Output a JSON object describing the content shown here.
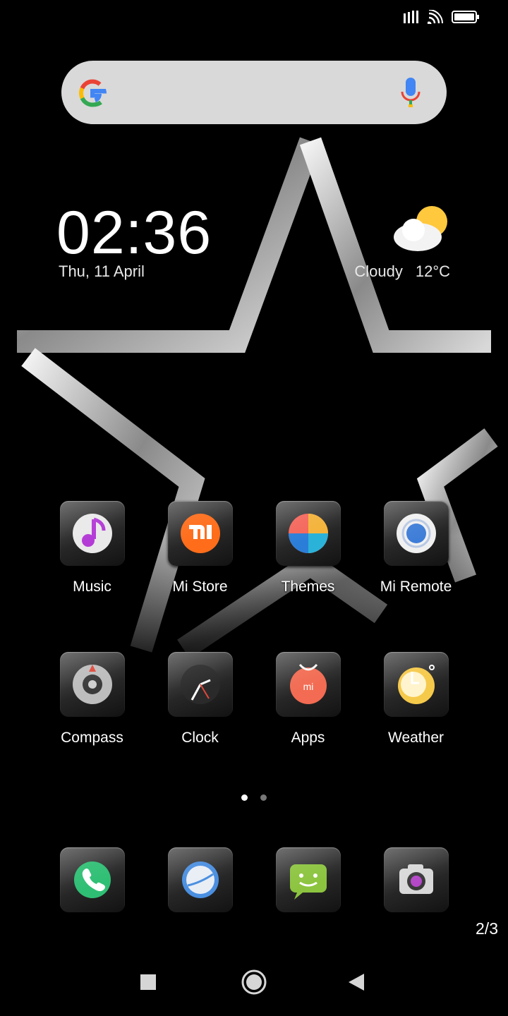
{
  "status_bar": {
    "signal_icon": "signal-bars-icon",
    "wifi_icon": "wifi-icon",
    "battery_icon": "battery-icon"
  },
  "search": {
    "value": "",
    "logo_icon": "google-g-icon",
    "mic_icon": "microphone-icon"
  },
  "clock_widget": {
    "time": "02:36",
    "date": "Thu, 11 April"
  },
  "weather_widget": {
    "condition": "Cloudy",
    "temperature": "12°C",
    "icon": "partly-cloudy-icon"
  },
  "apps": [
    {
      "label": "Music",
      "icon": "music-note-icon"
    },
    {
      "label": "Mi Store",
      "icon": "mi-logo-icon"
    },
    {
      "label": "Themes",
      "icon": "themes-icon"
    },
    {
      "label": "Mi Remote",
      "icon": "remote-icon"
    },
    {
      "label": "Compass",
      "icon": "compass-icon"
    },
    {
      "label": "Clock",
      "icon": "clock-icon"
    },
    {
      "label": "Apps",
      "icon": "app-store-bag-icon"
    },
    {
      "label": "Weather",
      "icon": "weather-sun-icon"
    }
  ],
  "dock": [
    {
      "icon": "phone-icon"
    },
    {
      "icon": "browser-icon"
    },
    {
      "icon": "messaging-icon"
    },
    {
      "icon": "camera-icon"
    }
  ],
  "pager": {
    "pages": 2,
    "active": 1
  },
  "page_counter": "2/3",
  "nav": {
    "recents_icon": "square-recents-icon",
    "home_icon": "circle-home-icon",
    "back_icon": "triangle-back-icon"
  },
  "colors": {
    "background": "#000000",
    "search_bar": "#ececec",
    "text": "#ffffff"
  }
}
